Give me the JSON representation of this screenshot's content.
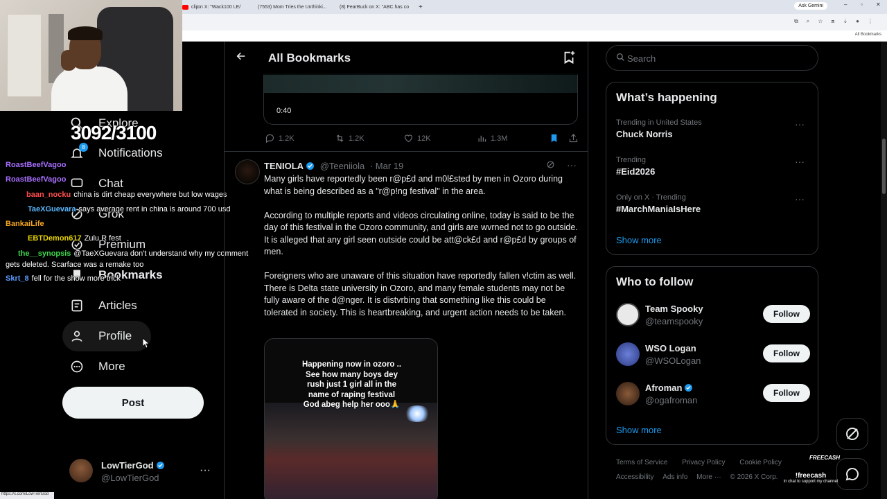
{
  "browser": {
    "tabs": [
      {
        "label": "clip",
        "fav_color": "#ff0000"
      },
      {
        "label": "on X: \"Wack100 LE/",
        "fav_color": "#000000"
      },
      {
        "label": "(7553) Mom Tries the Unthinki...",
        "fav_color": "#ff0000"
      },
      {
        "label": "(8) FearBuck on X: \"ABC has co",
        "fav_color": "#000000"
      }
    ],
    "new_tab": "+",
    "ask_gemini": "Ask Gemini",
    "all_bookmarks": "All Bookmarks",
    "status_url": "https://x.com/LowTierGod"
  },
  "stream": {
    "counter": "3092/3100",
    "chat": [
      {
        "user": "RoastBeefVagoo",
        "color": "#a970ff",
        "text": ""
      },
      {
        "user": "RoastBeefVagoo",
        "color": "#a970ff",
        "text": ""
      },
      {
        "user": "baan_nocku",
        "color": "#ff4f4f",
        "text": "china is dirt cheap everywhere but low wages"
      },
      {
        "user": "TaeXGuevara",
        "color": "#5cb8ff",
        "text": "says average rent in china is around 700 usd"
      },
      {
        "user": "BankaiLife",
        "color": "#f5a623",
        "text": ""
      },
      {
        "user": "EBTDemon617",
        "color": "#e5d200",
        "text": "Zulu R fest"
      },
      {
        "user": "the__synopsis",
        "color": "#3fd94f",
        "text": "@TaeXGuevara don't understand why my comment"
      },
      {
        "user": "",
        "color": "#ffffff",
        "text": "gets deleted. Scarface was a remake too"
      },
      {
        "user": "Skrt_8",
        "color": "#5c9bff",
        "text": "fell for the show more trick"
      }
    ]
  },
  "nav": {
    "items": [
      {
        "label": "Explore",
        "icon": "search-icon"
      },
      {
        "label": "Notifications",
        "icon": "bell-icon",
        "badge": "8"
      },
      {
        "label": "Chat",
        "icon": "chat-icon"
      },
      {
        "label": "Grok",
        "icon": "grok-icon"
      },
      {
        "label": "Premium",
        "icon": "premium-icon"
      },
      {
        "label": "Bookmarks",
        "icon": "bookmark-icon"
      },
      {
        "label": "Articles",
        "icon": "articles-icon"
      },
      {
        "label": "Profile",
        "icon": "profile-icon"
      },
      {
        "label": "More",
        "icon": "more-icon"
      }
    ],
    "post_label": "Post",
    "account": {
      "name": "LowTierGod",
      "handle": "@LowTierGod",
      "menu": "···"
    }
  },
  "main": {
    "title": "All Bookmarks",
    "prev_tweet": {
      "duration": "0:40",
      "replies": "1.2K",
      "retweets": "1.2K",
      "likes": "12K",
      "views": "1.3M"
    },
    "tweet": {
      "name": "TENIOLA",
      "handle": "@Teeniiola",
      "date": "· Mar 19",
      "paragraphs": [
        "Many girls have reportedly been r@p£d and m0l£sted by men in Ozoro during what is being described as a \"r@p!ng festival\" in the area.",
        "According to multiple reports and videos circulating online, today is said to be the day of this festival in the Ozoro community, and girls are wvrned not to go outside. It is alleged that any girl seen outside could be att@ck£d and r@p£d by groups of men.",
        "Foreigners who are unaware of this situation have reportedly fallen v!ctim as well. There is Delta state university in Ozoro, and many female students may not be fully aware of the d@nger. It is distvrbing that something like this could be tolerated in society. This is heartbreaking, and urgent action needs to be taken."
      ],
      "media_caption": "Happening now in ozoro ..\nSee how many boys dey\nrush just 1 girl all in the\nname of raping festival\nGod abeg help her ooo🙏"
    }
  },
  "sidebar": {
    "search_placeholder": "Search",
    "happening": {
      "title": "What’s happening",
      "trends": [
        {
          "meta": "Trending in United States",
          "topic": "Chuck Norris"
        },
        {
          "meta": "Trending",
          "topic": "#Eid2026"
        },
        {
          "meta": "Only on X · Trending",
          "topic": "#MarchManiaIsHere"
        }
      ],
      "show_more": "Show more"
    },
    "follow": {
      "title": "Who to follow",
      "accounts": [
        {
          "name": "Team Spooky",
          "handle": "@teamspooky",
          "verified": false,
          "avatar_color": "#e9e9e9"
        },
        {
          "name": "WSO Logan",
          "handle": "@WSOLogan",
          "verified": false,
          "avatar_color": "#3b4fa0"
        },
        {
          "name": "Afroman",
          "handle": "@ogafroman",
          "verified": true,
          "avatar_color": "#5a3a22"
        }
      ],
      "follow_label": "Follow",
      "show_more": "Show more"
    },
    "footer": {
      "line1": [
        "Terms of Service",
        "Privacy Policy",
        "Cookie Policy"
      ],
      "line2": [
        "Accessibility",
        "Ads info",
        "More ···",
        "© 2026 X Corp."
      ]
    },
    "freecash": {
      "brand": "FREECASH",
      "cmd": "!freecash",
      "sub": "in chat to support my channel"
    }
  },
  "colors": {
    "accent": "#1d9bf0",
    "bg": "#000000",
    "border": "#2f3336",
    "muted": "#71767b"
  }
}
